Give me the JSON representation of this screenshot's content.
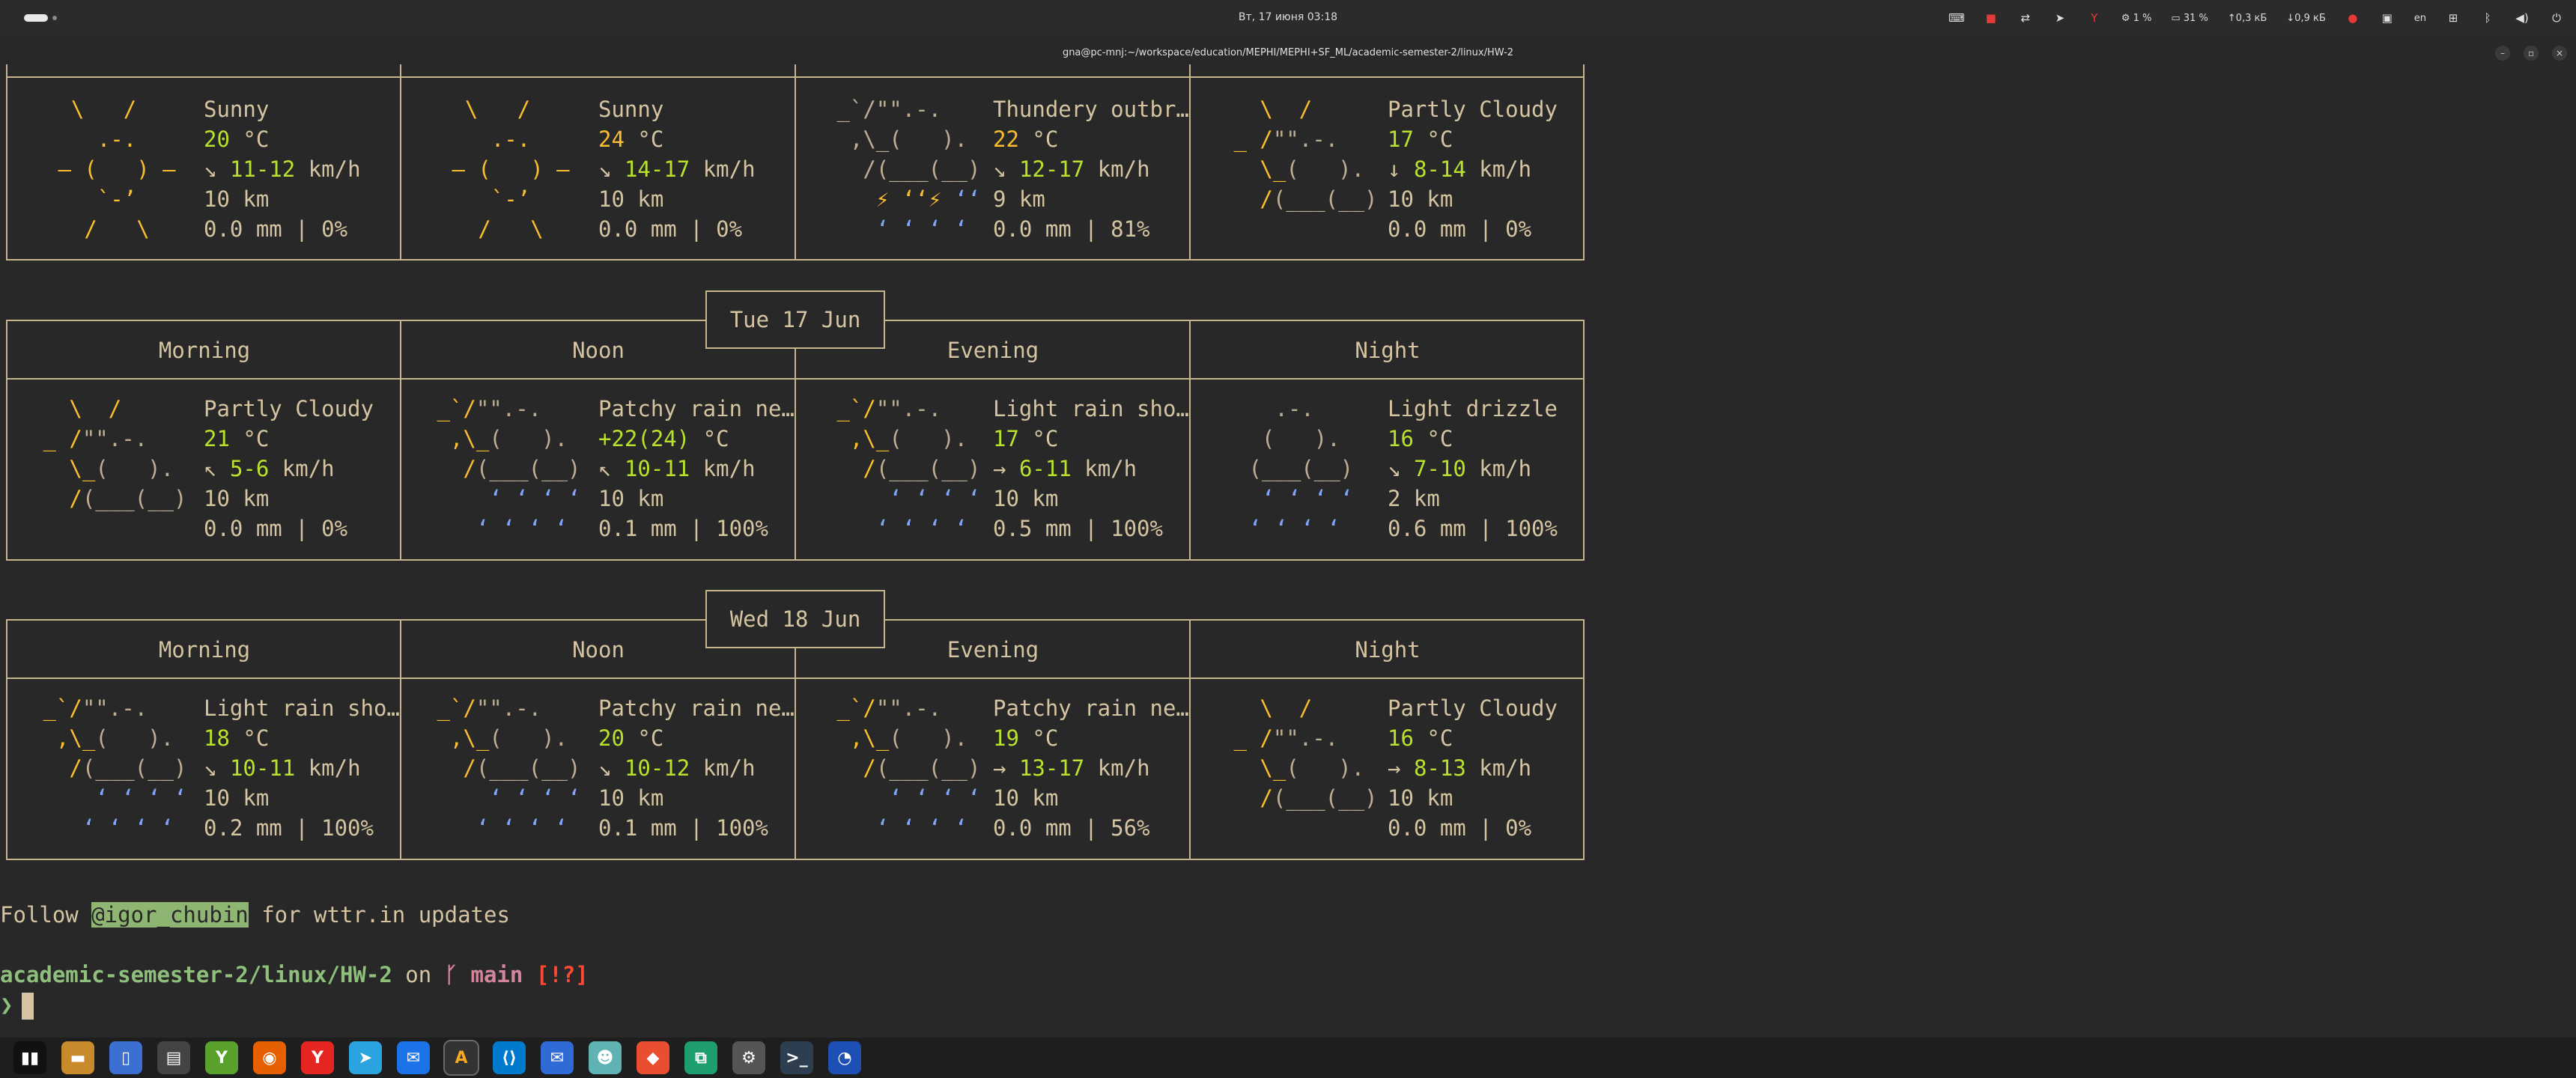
{
  "topbar": {
    "datetime": "Вт, 17 июня  03:18",
    "cpu": "1 %",
    "mem": "31 %",
    "up": "↑0,3 кБ",
    "down": "↓0,9 кБ",
    "lang": "en"
  },
  "window": {
    "title": "gna@pc-mnj:~/workspace/education/MEPHI/MEPHI+SF_ML/academic-semester-2/linux/HW-2"
  },
  "weather": {
    "partial": [
      {
        "cond": "Sunny",
        "temp": "20",
        "wind_arrow": "↘",
        "wind": "11-12",
        "vis": "10 km",
        "precip": "0.0 mm | 0%"
      },
      {
        "cond": "Sunny",
        "temp": "24",
        "wind_arrow": "↘",
        "wind": "14-17",
        "vis": "10 km",
        "precip": "0.0 mm | 0%"
      },
      {
        "cond": "Thundery outbr…",
        "temp": "22",
        "wind_arrow": "↘",
        "wind": "12-17",
        "vis": "9 km",
        "precip": "0.0 mm | 81%"
      },
      {
        "cond": "Partly Cloudy",
        "temp": "17",
        "wind_arrow": "↓",
        "wind": "8-14",
        "vis": "10 km",
        "precip": "0.0 mm | 0%"
      }
    ],
    "days": [
      {
        "date": "Tue 17 Jun",
        "headers": [
          "Morning",
          "Noon",
          "Evening",
          "Night"
        ],
        "cells": [
          {
            "cond": "Partly Cloudy",
            "temp": "21",
            "wind_arrow": "↖",
            "wind": "5-6",
            "vis": "10 km",
            "precip": "0.0 mm | 0%"
          },
          {
            "cond": "Patchy rain ne…",
            "temp": "+22(24)",
            "wind_arrow": "↖",
            "wind": "10-11",
            "vis": "10 km",
            "precip": "0.1 mm | 100%"
          },
          {
            "cond": "Light rain sho…",
            "temp": "17",
            "wind_arrow": "→",
            "wind": "6-11",
            "vis": "10 km",
            "precip": "0.5 mm | 100%"
          },
          {
            "cond": "Light drizzle",
            "temp": "16",
            "wind_arrow": "↘",
            "wind": "7-10",
            "vis": "2 km",
            "precip": "0.6 mm | 100%"
          }
        ]
      },
      {
        "date": "Wed 18 Jun",
        "headers": [
          "Morning",
          "Noon",
          "Evening",
          "Night"
        ],
        "cells": [
          {
            "cond": "Light rain sho…",
            "temp": "18",
            "wind_arrow": "↘",
            "wind": "10-11",
            "vis": "10 km",
            "precip": "0.2 mm | 100%"
          },
          {
            "cond": "Patchy rain ne…",
            "temp": "20",
            "wind_arrow": "↘",
            "wind": "10-12",
            "vis": "10 km",
            "precip": "0.1 mm | 100%"
          },
          {
            "cond": "Patchy rain ne…",
            "temp": "19",
            "wind_arrow": "→",
            "wind": "13-17",
            "vis": "10 km",
            "precip": "0.0 mm | 56%"
          },
          {
            "cond": "Partly Cloudy",
            "temp": "16",
            "wind_arrow": "→",
            "wind": "8-13",
            "vis": "10 km",
            "precip": "0.0 mm | 0%"
          }
        ]
      }
    ],
    "units": {
      "temp": "°C",
      "wind": "km/h"
    }
  },
  "follow": {
    "before": "Follow ",
    "handle": "@igor_chubin",
    "after": " for wttr.in updates"
  },
  "prompt": {
    "path": "academic-semester-2/linux/HW-2",
    "on": " on ",
    "branch_icon": "",
    "branch": "main",
    "status": "[!?]",
    "caret": "❯"
  },
  "dock": [
    "menu-icon",
    "files-icon",
    "phone-icon",
    "explorer-icon",
    "yandex-disk-icon",
    "firefox-icon",
    "yandex-browser-icon",
    "telegram-icon",
    "thunderbird-icon",
    "terminal-alacritty-icon",
    "vscode-icon",
    "mail-icon",
    "cat-icon",
    "git-icon",
    "office-icon",
    "steam-icon",
    "console-icon",
    "clock-icon"
  ]
}
